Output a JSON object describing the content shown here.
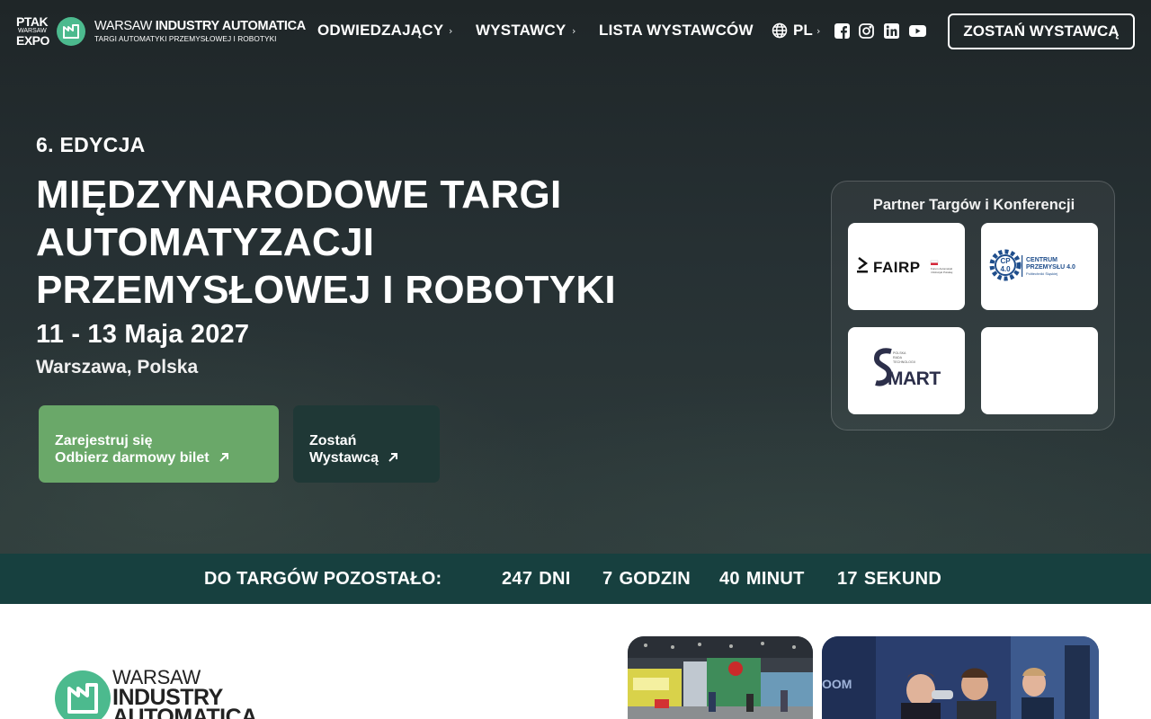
{
  "nav": {
    "ptak_logo": {
      "line1": "PTAK",
      "line2": "WARSAW",
      "line3": "EXPO"
    },
    "brand": {
      "line1_light": "WARSAW ",
      "line1_bold": "INDUSTRY AUTOMATICA",
      "line2": "TARGI AUTOMATYKI PRZEMYSŁOWEJ I ROBOTYKI"
    },
    "items": [
      {
        "label": "ODWIEDZAJĄCY",
        "has_submenu": true
      },
      {
        "label": "WYSTAWCY",
        "has_submenu": true
      },
      {
        "label": "LISTA WYSTAWCÓW",
        "has_submenu": false
      }
    ],
    "language": "PL",
    "social_icons": [
      "facebook-icon",
      "instagram-icon",
      "linkedin-icon",
      "youtube-icon"
    ],
    "cta_label": "ZOSTAŃ WYSTAWCĄ"
  },
  "hero": {
    "edition": "6. EDYCJA",
    "title_lines": [
      "MIĘDZYNARODOWE TARGI",
      "AUTOMATYZACJI",
      "PRZEMYSŁOWEJ I ROBOTYKI"
    ],
    "dates": "11 - 13 Maja 2027",
    "location": "Warszawa, Polska",
    "register_button": {
      "line1": "Zarejestruj się",
      "line2": "Odbierz darmowy bilet"
    },
    "exhibitor_button": {
      "line1": "Zostań",
      "line2": "Wystawcą"
    }
  },
  "partners": {
    "title": "Partner Targów i Konferencji",
    "logos": [
      {
        "name": "FAIRP",
        "small": "Forum Automatyki i Robotyki Polskiej"
      },
      {
        "name": "CENTRUM PRZEMYSŁU 4.0",
        "badge": "CP 4.0",
        "small": "Politechniki Śląskiej"
      },
      {
        "name": "SMART",
        "small": "POLSKA RADA TECHNOLOGII"
      },
      {
        "name": ""
      }
    ]
  },
  "countdown": {
    "label": "DO TARGÓW POZOSTAŁO:",
    "units": [
      {
        "value": "247",
        "unit": "DNI"
      },
      {
        "value": "7",
        "unit": "GODZIN"
      },
      {
        "value": "40",
        "unit": "MINUT"
      },
      {
        "value": "17",
        "unit": "SEKUND"
      }
    ]
  },
  "lower": {
    "logo_line1": "WARSAW",
    "logo_line2": "INDUSTRY",
    "logo_line3": "AUTOMATICA"
  },
  "colors": {
    "accent_green": "#4cba8e",
    "register_green": "#6aa869",
    "countdown_bar": "#17403f",
    "exhibitor_dark": "#1f3836"
  }
}
